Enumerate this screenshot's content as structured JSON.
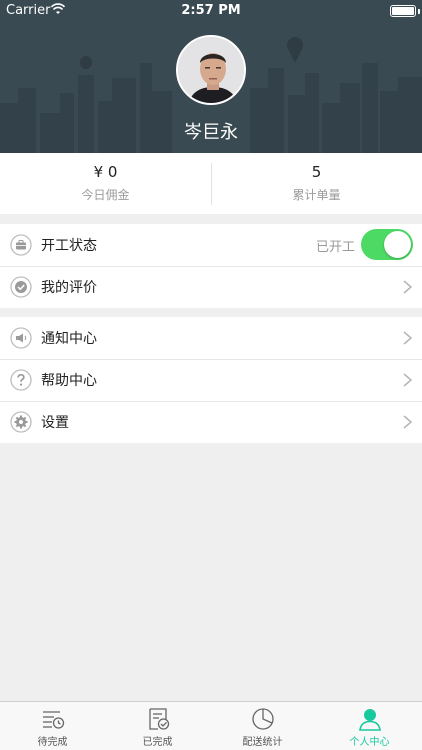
{
  "status_bar": {
    "carrier": "Carrier",
    "time": "2:57 PM"
  },
  "profile": {
    "name": "岑巨永"
  },
  "stats": {
    "today_commission": {
      "value": "¥ 0",
      "label": "今日佣金"
    },
    "total_orders": {
      "value": "5",
      "label": "累计单量"
    }
  },
  "menu": {
    "work_status": {
      "label": "开工状态",
      "status": "已开工",
      "toggle_on": true
    },
    "my_reviews": {
      "label": "我的评价"
    },
    "notifications": {
      "label": "通知中心"
    },
    "help": {
      "label": "帮助中心"
    },
    "settings": {
      "label": "设置"
    }
  },
  "tabbar": {
    "tabs": [
      {
        "label": "待完成",
        "icon": "pending-list-icon"
      },
      {
        "label": "已完成",
        "icon": "completed-list-icon"
      },
      {
        "label": "配送统计",
        "icon": "pie-chart-icon"
      },
      {
        "label": "个人中心",
        "icon": "person-icon",
        "active": true
      }
    ]
  },
  "colors": {
    "header_bg": "#3a4a52",
    "toggle_on": "#4cd964",
    "active_tab": "#18c9a0"
  }
}
